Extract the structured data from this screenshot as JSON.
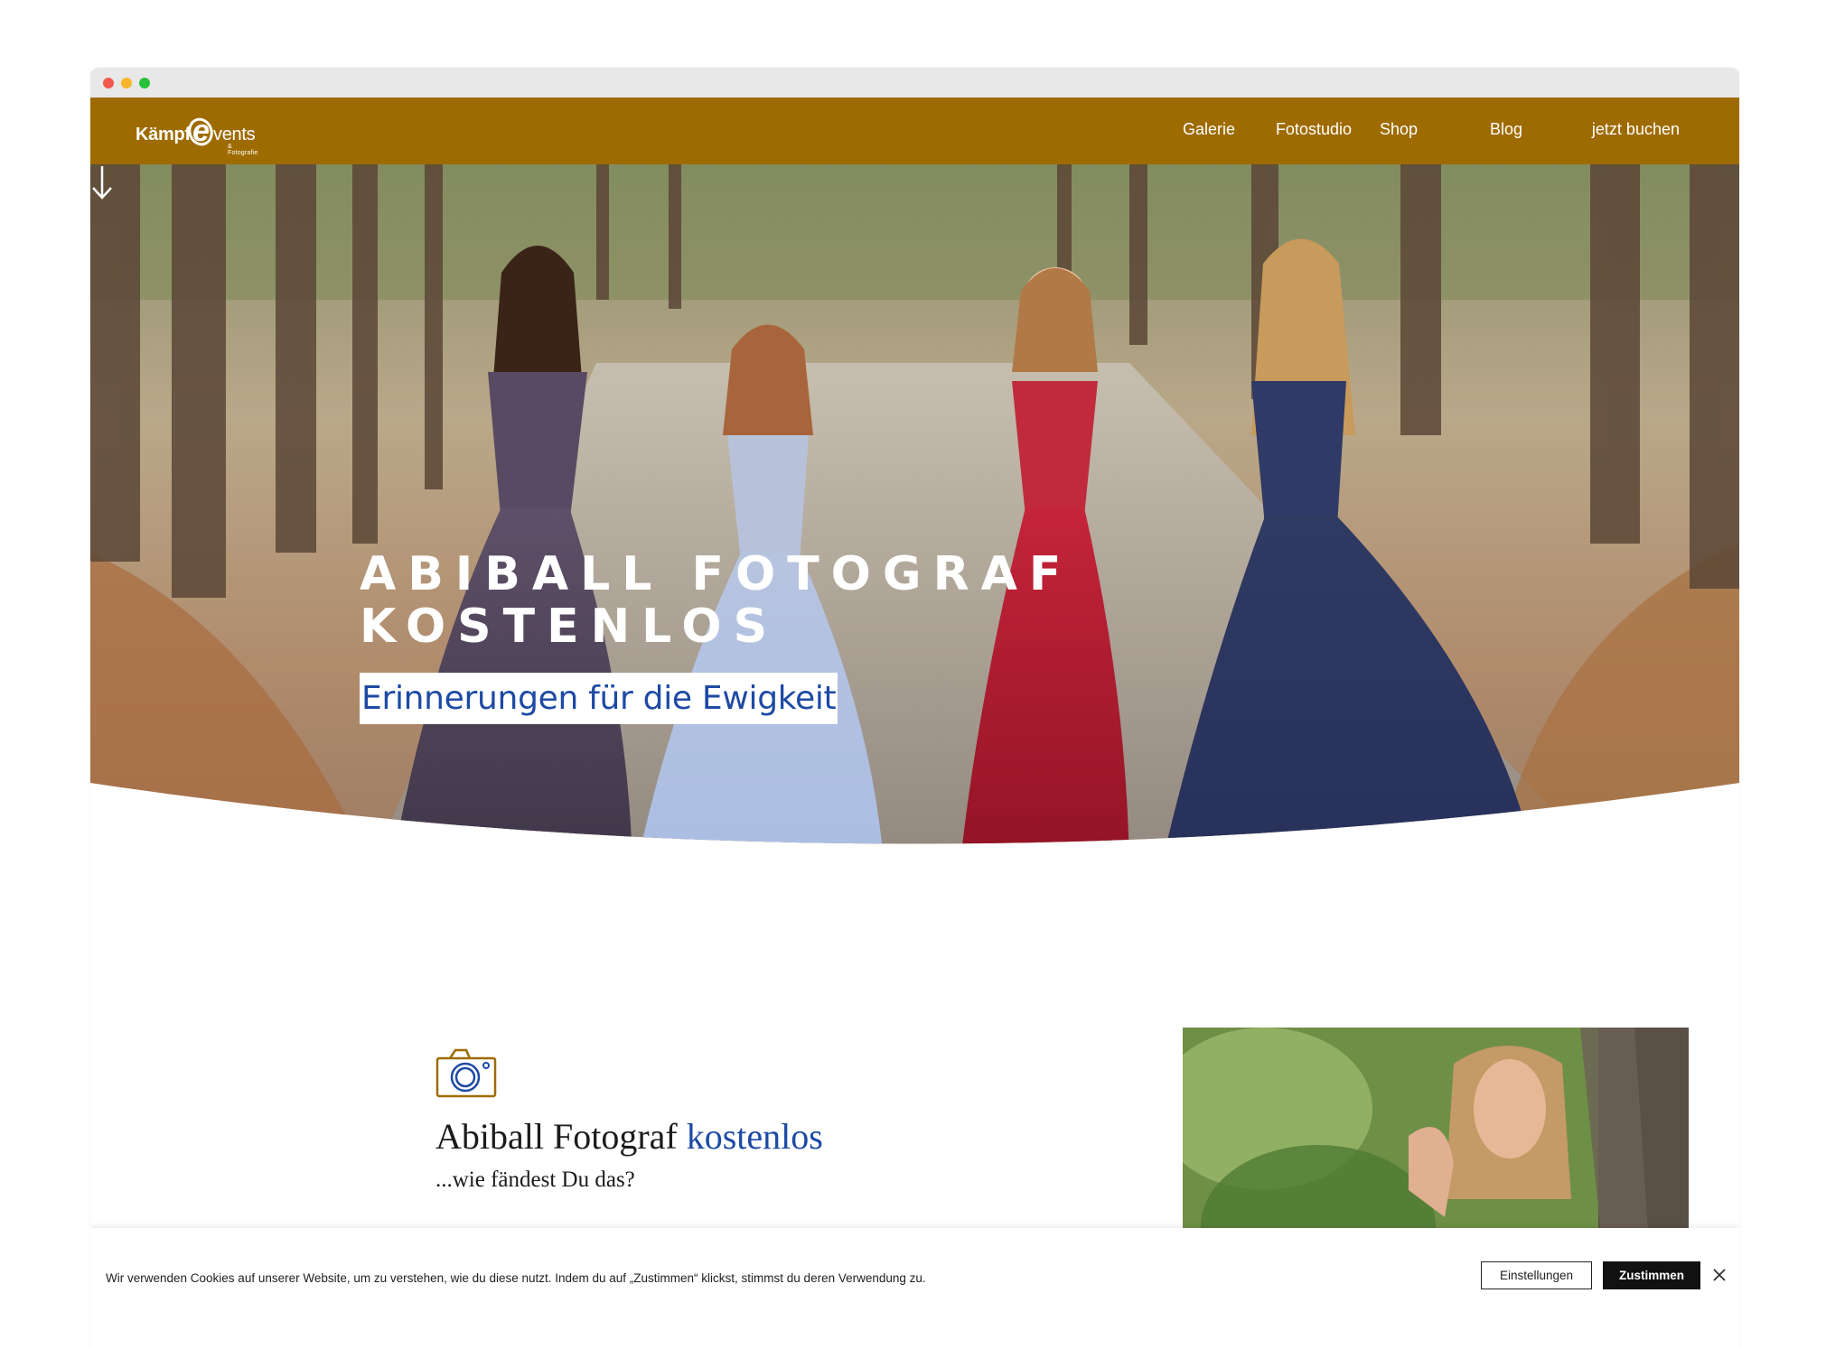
{
  "nav": {
    "brand_main": "Kämpf",
    "brand_letter": "e",
    "brand_rest": "vents",
    "brand_sub": "& Fotografie",
    "items": [
      {
        "label": "Galerie"
      },
      {
        "label": "Fotostudio"
      },
      {
        "label": "Shop"
      },
      {
        "label": "Blog"
      },
      {
        "label": "jetzt buchen"
      }
    ]
  },
  "hero": {
    "title_line1": "ABIBALL FOTOGRAF",
    "title_line2": "KOSTENLOS",
    "subtitle": "Erinnerungen für die Ewigkeit",
    "arrow_icon": "arrow-down-icon"
  },
  "section": {
    "icon": "camera-icon",
    "title_main": "Abiball Fotograf ",
    "title_accent": "kostenlos",
    "subtitle": "...wie fändest Du das?"
  },
  "cookie": {
    "text": "Wir verwenden Cookies auf unserer Website, um zu verstehen, wie du diese nutzt. Indem du auf „Zustimmen“ klickst, stimmst du deren Verwendung zu.",
    "settings_label": "Einstellungen",
    "accept_label": "Zustimmen",
    "close_icon": "close-icon"
  },
  "colors": {
    "nav_bg": "#9e6b00",
    "accent_blue": "#1d4aa4"
  }
}
